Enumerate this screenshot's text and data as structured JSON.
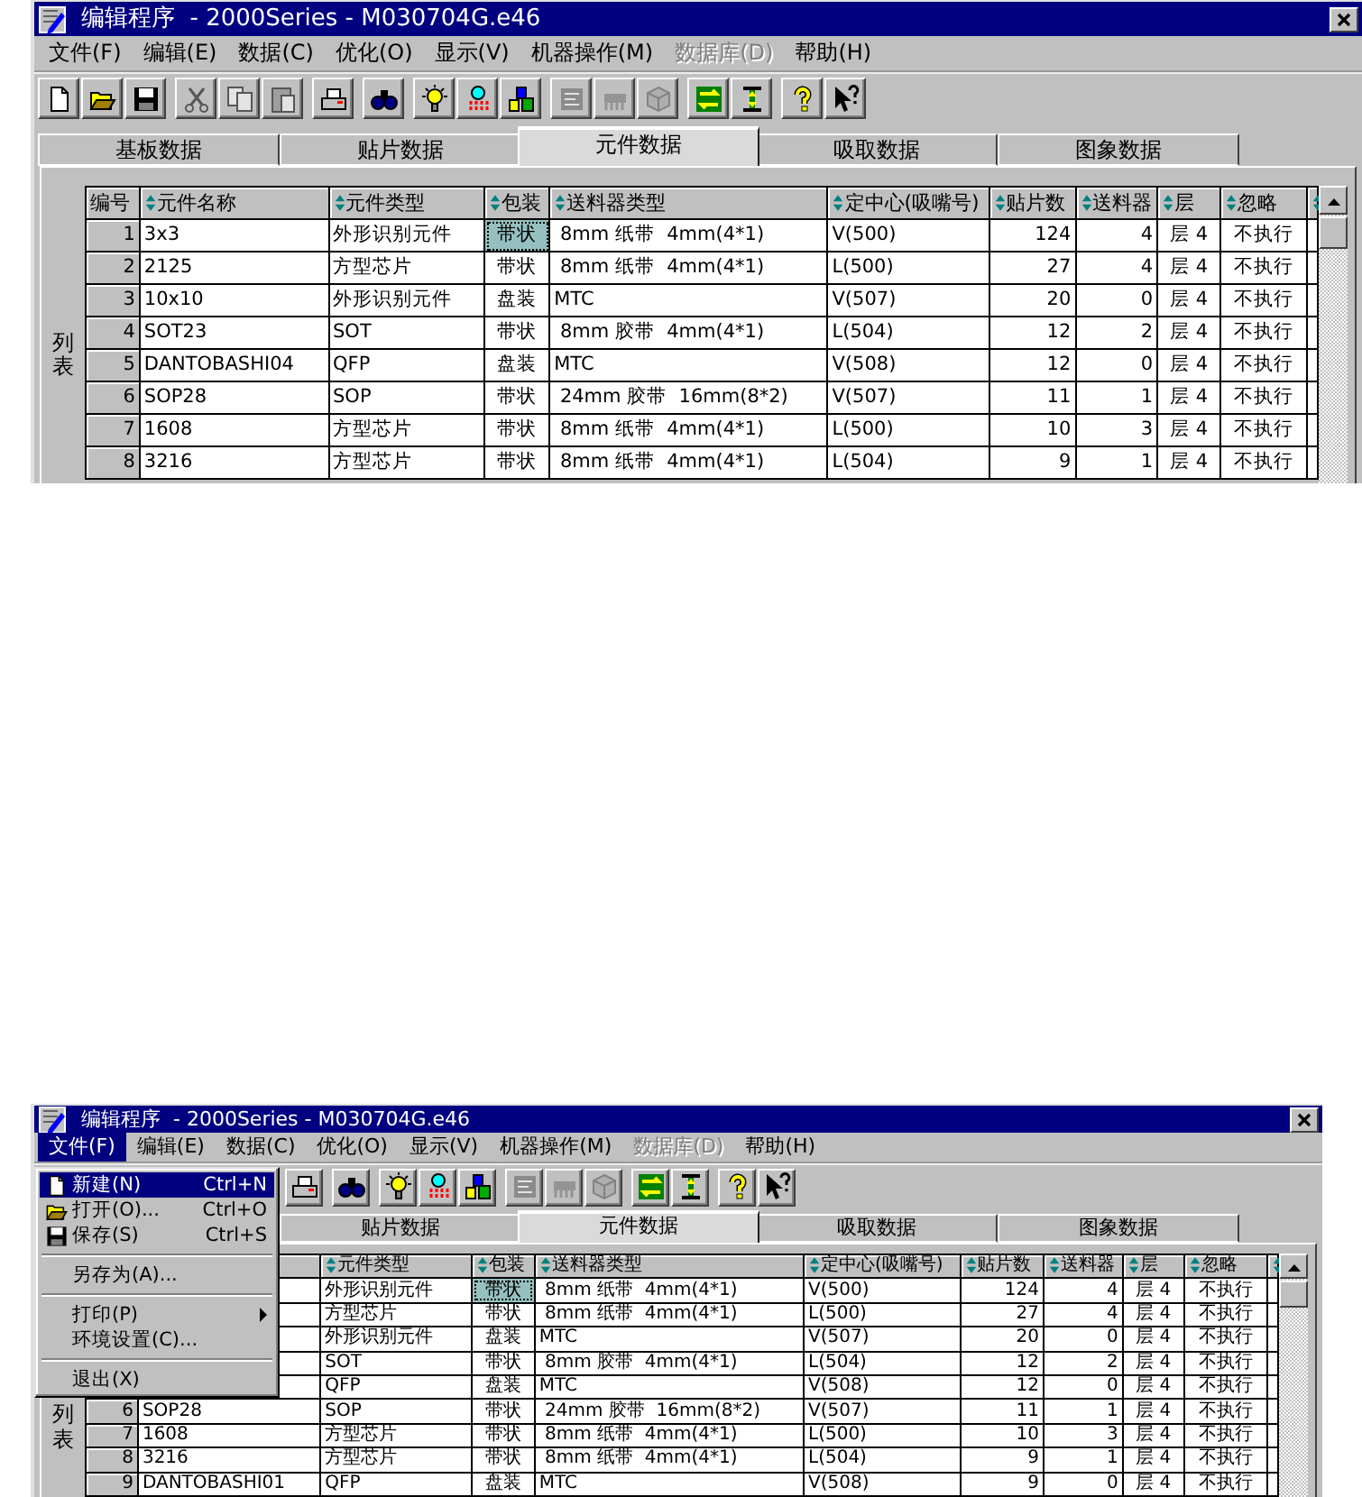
{
  "screens": [
    {
      "window": {
        "title": "编辑程序  - 2000Series - M030704G.e46"
      },
      "menu": [
        {
          "label": "文件(F)",
          "disabled": false,
          "selected": false
        },
        {
          "label": "编辑(E)",
          "disabled": false,
          "selected": false
        },
        {
          "label": "数据(C)",
          "disabled": false,
          "selected": false
        },
        {
          "label": "优化(O)",
          "disabled": false,
          "selected": false
        },
        {
          "label": "显示(V)",
          "disabled": false,
          "selected": false
        },
        {
          "label": "机器操作(M)",
          "disabled": false,
          "selected": false
        },
        {
          "label": "数据库(D)",
          "disabled": true,
          "selected": false
        },
        {
          "label": "帮助(H)",
          "disabled": false,
          "selected": false
        }
      ],
      "toolbar": [
        [
          {
            "kind": "new",
            "disabled": false
          },
          {
            "kind": "open",
            "disabled": false
          },
          {
            "kind": "save",
            "disabled": false
          }
        ],
        [
          {
            "kind": "cut",
            "disabled": true
          },
          {
            "kind": "copy",
            "disabled": true
          },
          {
            "kind": "paste",
            "disabled": true
          }
        ],
        [
          {
            "kind": "print",
            "disabled": false
          }
        ],
        [
          {
            "kind": "find",
            "disabled": false
          }
        ],
        [
          {
            "kind": "bulb",
            "disabled": false
          },
          {
            "kind": "probe",
            "disabled": false
          },
          {
            "kind": "blocks",
            "disabled": false
          }
        ],
        [
          {
            "kind": "board",
            "disabled": true
          },
          {
            "kind": "comb",
            "disabled": true
          },
          {
            "kind": "cube",
            "disabled": true
          }
        ],
        [
          {
            "kind": "swap",
            "disabled": false
          },
          {
            "kind": "height",
            "disabled": false
          }
        ],
        [
          {
            "kind": "help",
            "disabled": false
          },
          {
            "kind": "whatsthis",
            "disabled": false
          }
        ]
      ],
      "tabs": [
        {
          "label": "基板数据",
          "selected": false
        },
        {
          "label": "贴片数据",
          "selected": false
        },
        {
          "label": "元件数据",
          "selected": true
        },
        {
          "label": "吸取数据",
          "selected": false
        },
        {
          "label": "图象数据",
          "selected": false
        }
      ],
      "side_label": "列表",
      "table": {
        "columns": [
          {
            "label": "编号",
            "sortable": false
          },
          {
            "label": "元件名称",
            "sortable": true
          },
          {
            "label": "元件类型",
            "sortable": true
          },
          {
            "label": "包装",
            "sortable": true
          },
          {
            "label": "送料器类型",
            "sortable": true
          },
          {
            "label": "定中心(吸嘴号)",
            "sortable": true
          },
          {
            "label": "贴片数",
            "sortable": true
          },
          {
            "label": "送料器",
            "sortable": true
          },
          {
            "label": "层",
            "sortable": true
          },
          {
            "label": "忽略",
            "sortable": true
          },
          {
            "sortable": true
          }
        ],
        "rows": [
          {
            "no": "1",
            "name": "3x3",
            "type": "外形识别元件",
            "package": {
              "text": "带状",
              "selected": true
            },
            "feeder_type": " 8mm 纸带  4mm(4*1)",
            "center": "V(500)",
            "count": "124",
            "feeder": "4",
            "layer": "层 4",
            "ignore": "不执行"
          },
          {
            "no": "2",
            "name": "2125",
            "type": "方型芯片",
            "package": {
              "text": "带状",
              "selected": false
            },
            "feeder_type": " 8mm 纸带  4mm(4*1)",
            "center": "L(500)",
            "count": "27",
            "feeder": "4",
            "layer": "层 4",
            "ignore": "不执行"
          },
          {
            "no": "3",
            "name": "10x10",
            "type": "外形识别元件",
            "package": {
              "text": "盘装",
              "selected": false
            },
            "feeder_type": "MTC",
            "center": "V(507)",
            "count": "20",
            "feeder": "0",
            "layer": "层 4",
            "ignore": "不执行"
          },
          {
            "no": "4",
            "name": "SOT23",
            "type": "SOT",
            "package": {
              "text": "带状",
              "selected": false
            },
            "feeder_type": " 8mm 胶带  4mm(4*1)",
            "center": "L(504)",
            "count": "12",
            "feeder": "2",
            "layer": "层 4",
            "ignore": "不执行"
          },
          {
            "no": "5",
            "name": "DANTOBASHI04",
            "type": "QFP",
            "package": {
              "text": "盘装",
              "selected": false
            },
            "feeder_type": "MTC",
            "center": "V(508)",
            "count": "12",
            "feeder": "0",
            "layer": "层 4",
            "ignore": "不执行"
          },
          {
            "no": "6",
            "name": "SOP28",
            "type": "SOP",
            "package": {
              "text": "带状",
              "selected": false
            },
            "feeder_type": " 24mm 胶带  16mm(8*2)",
            "center": "V(507)",
            "count": "11",
            "feeder": "1",
            "layer": "层 4",
            "ignore": "不执行"
          },
          {
            "no": "7",
            "name": "1608",
            "type": "方型芯片",
            "package": {
              "text": "带状",
              "selected": false
            },
            "feeder_type": " 8mm 纸带  4mm(4*1)",
            "center": "L(500)",
            "count": "10",
            "feeder": "3",
            "layer": "层 4",
            "ignore": "不执行"
          },
          {
            "no": "8",
            "name": "3216",
            "type": "方型芯片",
            "package": {
              "text": "带状",
              "selected": false
            },
            "feeder_type": " 8mm 纸带  4mm(4*1)",
            "center": "L(504)",
            "count": "9",
            "feeder": "1",
            "layer": "层 4",
            "ignore": "不执行"
          }
        ]
      }
    },
    {
      "window": {
        "title": "编辑程序  - 2000Series - M030704G.e46"
      },
      "menu": [
        {
          "label": "文件(F)",
          "disabled": false,
          "selected": true
        },
        {
          "label": "编辑(E)",
          "disabled": false,
          "selected": false
        },
        {
          "label": "数据(C)",
          "disabled": false,
          "selected": false
        },
        {
          "label": "优化(O)",
          "disabled": false,
          "selected": false
        },
        {
          "label": "显示(V)",
          "disabled": false,
          "selected": false
        },
        {
          "label": "机器操作(M)",
          "disabled": false,
          "selected": false
        },
        {
          "label": "数据库(D)",
          "disabled": true,
          "selected": false
        },
        {
          "label": "帮助(H)",
          "disabled": false,
          "selected": false
        }
      ],
      "open_menu": {
        "items": [
          {
            "kind": "new",
            "label": "新建(N)",
            "shortcut": "Ctrl+N",
            "selected": true,
            "submenu": false
          },
          {
            "kind": "open",
            "label": "打开(O)...",
            "shortcut": "Ctrl+O",
            "selected": false,
            "submenu": false
          },
          {
            "kind": "save",
            "label": "保存(S)",
            "shortcut": "Ctrl+S",
            "selected": false,
            "submenu": false
          },
          {
            "kind": "separator"
          },
          {
            "kind": "item",
            "label": "另存为(A)...",
            "selected": false,
            "submenu": false
          },
          {
            "kind": "separator"
          },
          {
            "kind": "item",
            "label": "打印(P)",
            "selected": false,
            "submenu": true
          },
          {
            "kind": "item",
            "label": "环境设置(C)...",
            "selected": false,
            "submenu": false
          },
          {
            "kind": "separator"
          },
          {
            "kind": "item",
            "label": "退出(X)",
            "selected": false,
            "submenu": false
          }
        ]
      },
      "toolbar": [
        [
          {
            "kind": "print",
            "disabled": false
          }
        ],
        [
          {
            "kind": "find",
            "disabled": false
          }
        ],
        [
          {
            "kind": "bulb",
            "disabled": false
          },
          {
            "kind": "probe",
            "disabled": false
          },
          {
            "kind": "blocks",
            "disabled": false
          }
        ],
        [
          {
            "kind": "board",
            "disabled": true
          },
          {
            "kind": "comb",
            "disabled": true
          },
          {
            "kind": "cube",
            "disabled": true
          }
        ],
        [
          {
            "kind": "swap",
            "disabled": false
          },
          {
            "kind": "height",
            "disabled": false
          }
        ],
        [
          {
            "kind": "help",
            "disabled": false
          },
          {
            "kind": "whatsthis",
            "disabled": false
          }
        ]
      ],
      "tabs": [
        {
          "label": "贴片数据",
          "selected": false
        },
        {
          "label": "元件数据",
          "selected": true
        },
        {
          "label": "吸取数据",
          "selected": false
        },
        {
          "label": "图象数据",
          "selected": false
        }
      ],
      "side_label": "列表",
      "table": {
        "columns": [
          {},
          {},
          {
            "label": "元件类型",
            "sortable": true
          },
          {
            "label": "包装",
            "sortable": true
          },
          {
            "label": "送料器类型",
            "sortable": true
          },
          {
            "label": "定中心(吸嘴号)",
            "sortable": true
          },
          {
            "label": "贴片数",
            "sortable": true
          },
          {
            "label": "送料器",
            "sortable": true
          },
          {
            "label": "层",
            "sortable": true
          },
          {
            "label": "忽略",
            "sortable": true
          },
          {
            "sortable": true
          }
        ],
        "rows": [
          {
            "type": "外形识别元件",
            "package": {
              "text": "带状",
              "selected": true
            },
            "feeder_type": " 8mm 纸带  4mm(4*1)",
            "center": "V(500)",
            "count": "124",
            "feeder": "4",
            "layer": "层 4",
            "ignore": "不执行"
          },
          {
            "type": "方型芯片",
            "package": {
              "text": "带状",
              "selected": false
            },
            "feeder_type": " 8mm 纸带  4mm(4*1)",
            "center": "L(500)",
            "count": "27",
            "feeder": "4",
            "layer": "层 4",
            "ignore": "不执行"
          },
          {
            "type": "外形识别元件",
            "package": {
              "text": "盘装",
              "selected": false
            },
            "feeder_type": "MTC",
            "center": "V(507)",
            "count": "20",
            "feeder": "0",
            "layer": "层 4",
            "ignore": "不执行"
          },
          {
            "type": "SOT",
            "package": {
              "text": "带状",
              "selected": false
            },
            "feeder_type": " 8mm 胶带  4mm(4*1)",
            "center": "L(504)",
            "count": "12",
            "feeder": "2",
            "layer": "层 4",
            "ignore": "不执行"
          },
          {
            "type": "QFP",
            "package": {
              "text": "盘装",
              "selected": false
            },
            "feeder_type": "MTC",
            "center": "V(508)",
            "count": "12",
            "feeder": "0",
            "layer": "层 4",
            "ignore": "不执行"
          },
          {
            "no": "6",
            "name": "SOP28",
            "type": "SOP",
            "package": {
              "text": "带状",
              "selected": false
            },
            "feeder_type": " 24mm 胶带  16mm(8*2)",
            "center": "V(507)",
            "count": "11",
            "feeder": "1",
            "layer": "层 4",
            "ignore": "不执行"
          },
          {
            "no": "7",
            "name": "1608",
            "type": "方型芯片",
            "package": {
              "text": "带状",
              "selected": false
            },
            "feeder_type": " 8mm 纸带  4mm(4*1)",
            "center": "L(500)",
            "count": "10",
            "feeder": "3",
            "layer": "层 4",
            "ignore": "不执行"
          },
          {
            "no": "8",
            "name": "3216",
            "type": "方型芯片",
            "package": {
              "text": "带状",
              "selected": false
            },
            "feeder_type": " 8mm 纸带  4mm(4*1)",
            "center": "L(504)",
            "count": "9",
            "feeder": "1",
            "layer": "层 4",
            "ignore": "不执行"
          },
          {
            "no": "9",
            "name": "DANTOBASHI01",
            "type": "QFP",
            "package": {
              "text": "盘装",
              "selected": false
            },
            "feeder_type": "MTC",
            "center": "V(508)",
            "count": "9",
            "feeder": "0",
            "layer": "层 4",
            "ignore": "不执行"
          }
        ]
      }
    }
  ]
}
